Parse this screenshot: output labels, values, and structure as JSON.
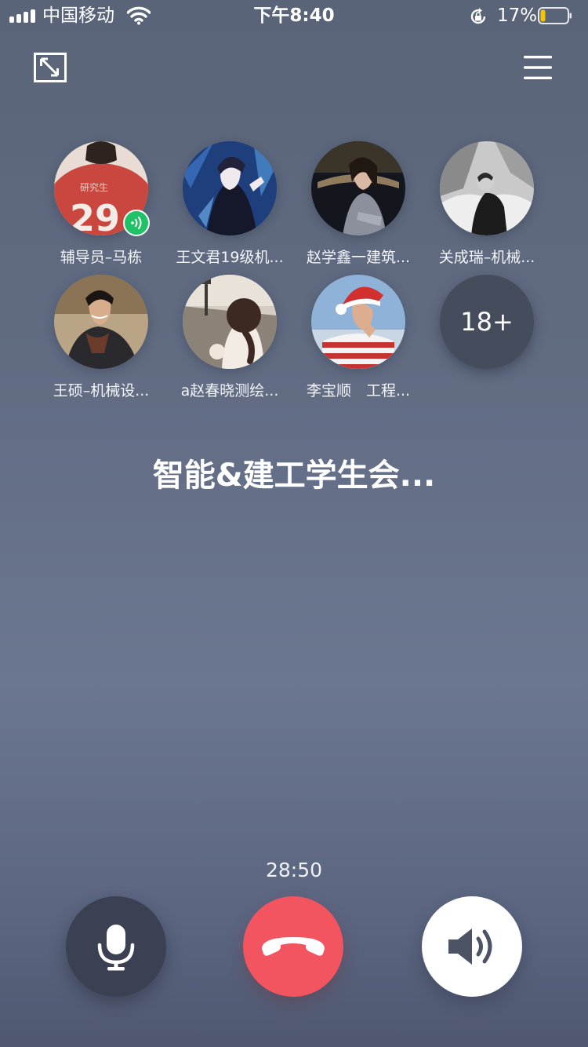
{
  "status_bar": {
    "carrier": "中国移动",
    "time": "下午8:40",
    "battery_percent": "17%",
    "battery_level": 0.17,
    "battery_color": "#f5c400"
  },
  "top_bar": {
    "minimize_icon": "minimize-icon",
    "menu_icon": "menu-icon"
  },
  "participants": [
    {
      "name": "辅导员–马栋",
      "speaking": true
    },
    {
      "name": "王文君19级机...",
      "speaking": false
    },
    {
      "name": "赵学鑫一建筑...",
      "speaking": false
    },
    {
      "name": "关成瑞–机械...",
      "speaking": false
    },
    {
      "name": "王硕–机械设...",
      "speaking": false
    },
    {
      "name": "a赵春晓测绘...",
      "speaking": false
    },
    {
      "name": "李宝顺　工程...",
      "speaking": false
    }
  ],
  "more_count": "18+",
  "group_name": "智能&建工学生会...",
  "call_duration": "28:50",
  "controls": {
    "mute_icon": "microphone-icon",
    "hangup_icon": "phone-hangup-icon",
    "speaker_icon": "speaker-icon",
    "hangup_color": "#f25460"
  },
  "speaking_color": "#21c267"
}
